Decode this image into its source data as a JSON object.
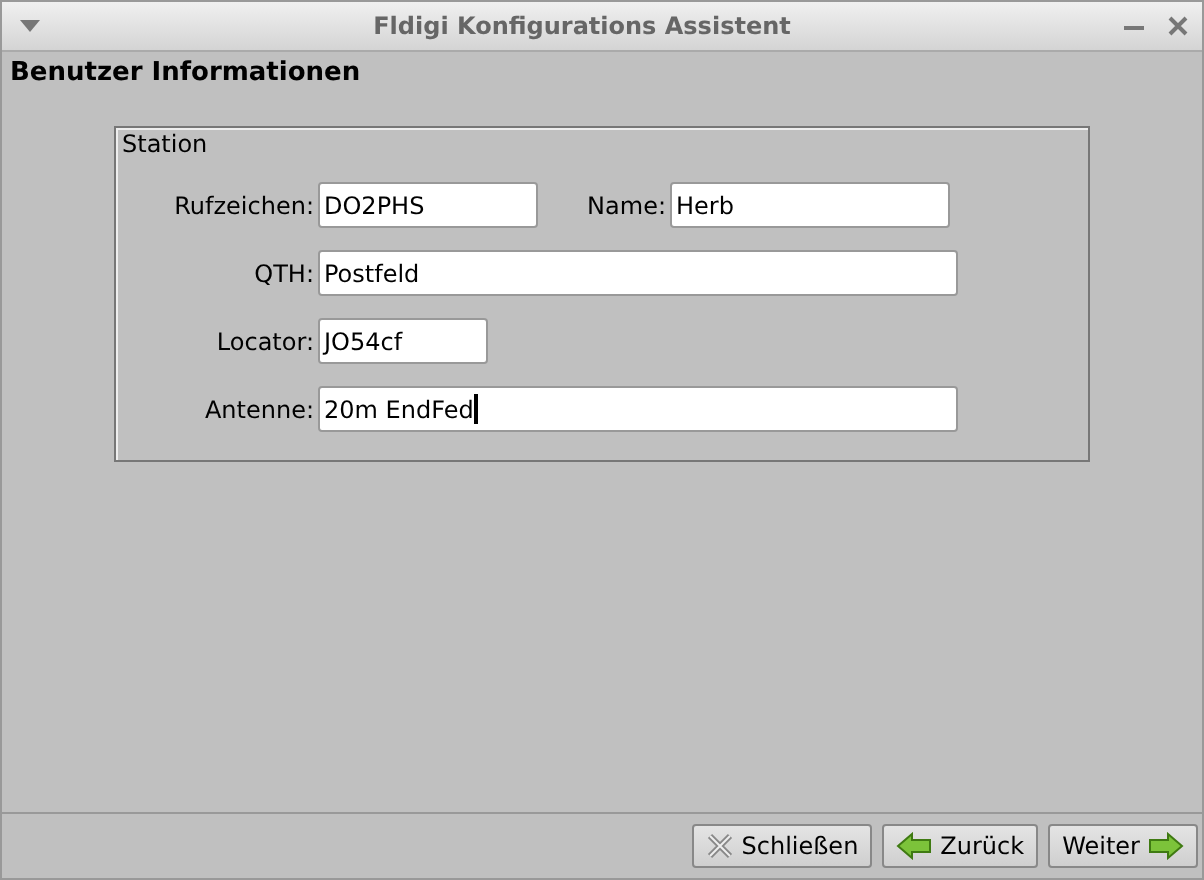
{
  "window": {
    "title": "Fldigi Konfigurations Assistent"
  },
  "heading": "Benutzer Informationen",
  "group": {
    "title": "Station",
    "rows": [
      {
        "fields": [
          {
            "label": "Rufzeichen:",
            "value": "DO2PHS",
            "focused": false
          },
          {
            "label": "Name:",
            "value": "Herb",
            "focused": false
          }
        ]
      },
      {
        "fields": [
          {
            "label": "QTH:",
            "value": "Postfeld",
            "focused": false
          }
        ]
      },
      {
        "fields": [
          {
            "label": "Locator:",
            "value": "JO54cf",
            "focused": false
          }
        ]
      },
      {
        "fields": [
          {
            "label": "Antenne:",
            "value": "20m EndFed",
            "focused": true
          }
        ]
      }
    ]
  },
  "buttons": [
    {
      "label": "Schließen",
      "kind": "close"
    },
    {
      "label": "Zurück",
      "kind": "back"
    },
    {
      "label": "Weiter",
      "kind": "next"
    }
  ]
}
